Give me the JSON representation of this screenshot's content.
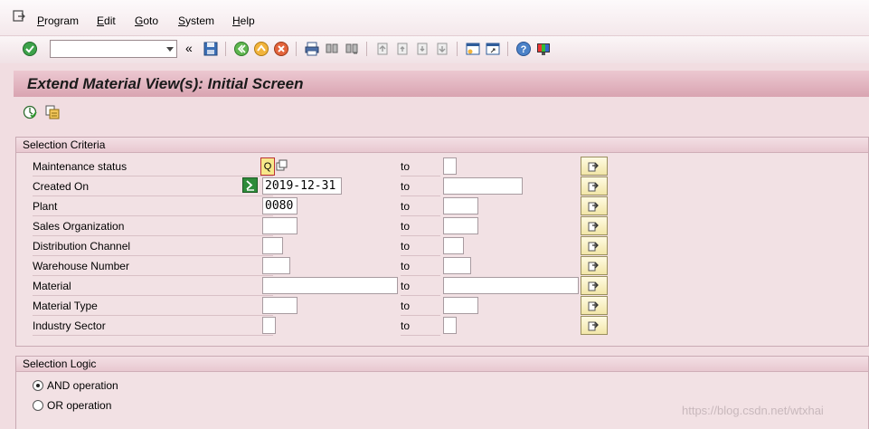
{
  "menu": {
    "items": [
      {
        "label": "Program",
        "key": "P"
      },
      {
        "label": "Edit",
        "key": "E"
      },
      {
        "label": "Goto",
        "key": "G"
      },
      {
        "label": "System",
        "key": "S"
      },
      {
        "label": "Help",
        "key": "H"
      }
    ]
  },
  "toolbar": {
    "command_field_value": "",
    "collapse_glyph": "«"
  },
  "title": "Extend Material View(s): Initial Screen",
  "selection_criteria": {
    "header": "Selection Criteria",
    "to_label": "to",
    "rows": [
      {
        "label": "Maintenance status",
        "from": "",
        "to": ""
      },
      {
        "label": "Created On",
        "from": "2019-12-31",
        "to": ""
      },
      {
        "label": "Plant",
        "from": "0080",
        "to": ""
      },
      {
        "label": "Sales Organization",
        "from": "",
        "to": ""
      },
      {
        "label": "Distribution Channel",
        "from": "",
        "to": ""
      },
      {
        "label": "Warehouse Number",
        "from": "",
        "to": ""
      },
      {
        "label": "Material",
        "from": "",
        "to": ""
      },
      {
        "label": "Material Type",
        "from": "",
        "to": ""
      },
      {
        "label": "Industry Sector",
        "from": "",
        "to": ""
      }
    ]
  },
  "selection_logic": {
    "header": "Selection Logic",
    "options": [
      {
        "label": "AND operation",
        "selected": true
      },
      {
        "label": "OR operation",
        "selected": false
      }
    ]
  },
  "watermark": "https://blog.csdn.net/wtxhai",
  "colors": {
    "background": "#f1dde1",
    "title_bar": "#d9a4b1",
    "multi_button": "#f2e6a8"
  }
}
